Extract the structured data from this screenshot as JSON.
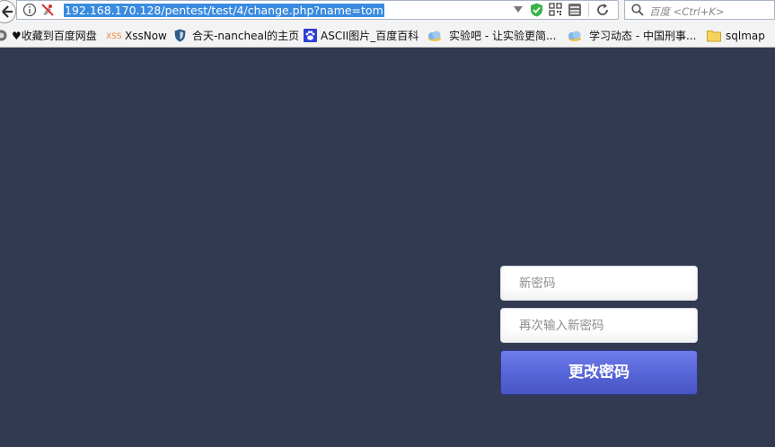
{
  "browser": {
    "url": "192.168.170.128/pentest/test/4/change.php?name=tom",
    "search_placeholder": "百度 <Ctrl+K>"
  },
  "bookmarks": [
    {
      "label": "♥收藏到百度网盘",
      "icon": "globe-icon"
    },
    {
      "label": "XssNow",
      "icon": "xss-icon"
    },
    {
      "label": "合天-nancheal的主页",
      "icon": "shield-icon"
    },
    {
      "label": "ASCII图片_百度百科",
      "icon": "baidu-paw-icon"
    },
    {
      "label": "实验吧 - 让实验更简...",
      "icon": "cloud-icon"
    },
    {
      "label": "学习动态 - 中国刑事...",
      "icon": "cloud-icon"
    },
    {
      "label": "sqlmap",
      "icon": "folder-icon"
    }
  ],
  "form": {
    "new_password_placeholder": "新密码",
    "confirm_password_placeholder": "再次输入新密码",
    "submit_label": "更改密码"
  },
  "colors": {
    "page_background": "#323a52",
    "button_gradient_top": "#6f7dea",
    "button_gradient_bottom": "#4a55c4",
    "url_highlight": "#3a8be0"
  }
}
